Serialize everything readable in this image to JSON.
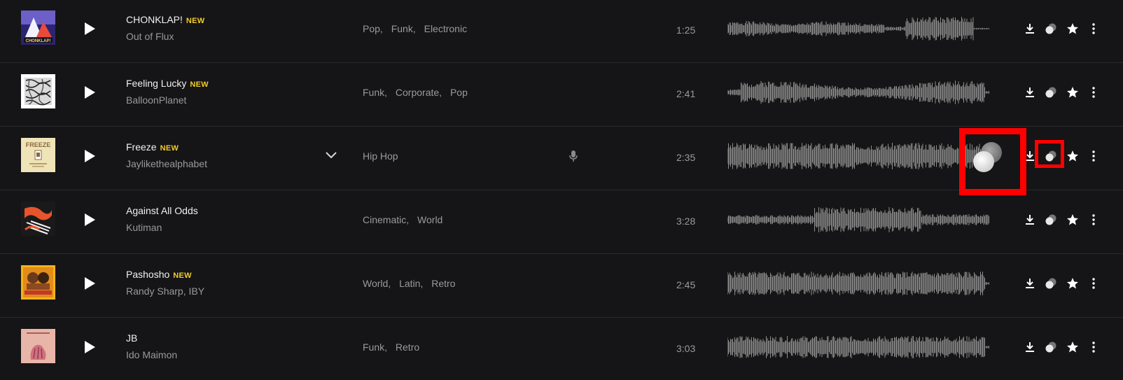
{
  "tracks": [
    {
      "title": "CHONKLAP!",
      "new": "NEW",
      "artist": "Out of Flux",
      "genres": [
        "Pop,",
        "Funk,",
        "Electronic"
      ],
      "duration": "1:25",
      "cover_text": "CHONKLAP!",
      "cover_colors": [
        "#3b2a7a",
        "#e6e6f5",
        "#c0392b"
      ]
    },
    {
      "title": "Feeling Lucky",
      "new": "NEW",
      "artist": "BalloonPlanet",
      "genres": [
        "Funk,",
        "Corporate,",
        "Pop"
      ],
      "duration": "2:41",
      "cover_colors": [
        "#ffffff",
        "#222222"
      ]
    },
    {
      "title": "Freeze",
      "new": "NEW",
      "artist": "Jaylikethealphabet",
      "genres": [
        "Hip Hop"
      ],
      "duration": "2:35",
      "cover_text": "FREEZE",
      "cover_colors": [
        "#efe3b8",
        "#8a6a3a"
      ]
    },
    {
      "title": "Against All Odds",
      "new": "",
      "artist": "Kutiman",
      "genres": [
        "Cinematic,",
        "World"
      ],
      "duration": "3:28",
      "cover_colors": [
        "#1a1a1a",
        "#e8542b"
      ]
    },
    {
      "title": "Pashosho",
      "new": "NEW",
      "artist": "Randy Sharp, IBY",
      "genres": [
        "World,",
        "Latin,",
        "Retro"
      ],
      "duration": "2:45",
      "cover_colors": [
        "#f3b318",
        "#6b3a1c"
      ]
    },
    {
      "title": "JB",
      "new": "",
      "artist": "Ido Maimon",
      "genres": [
        "Funk,",
        "Retro"
      ],
      "duration": "3:03",
      "cover_colors": [
        "#e8b6a8",
        "#c46a7a"
      ]
    }
  ],
  "icons": {
    "play": "play-icon",
    "download": "download-icon",
    "similar": "similar-tracks-icon",
    "favorite": "star-icon",
    "more": "more-vertical-icon",
    "expand": "chevron-down-icon",
    "vocals": "microphone-icon"
  },
  "colors": {
    "background": "#151416",
    "accent_new": "#f0cc2c",
    "highlight": "#ff0000",
    "waveform": "#8f8f8f"
  }
}
